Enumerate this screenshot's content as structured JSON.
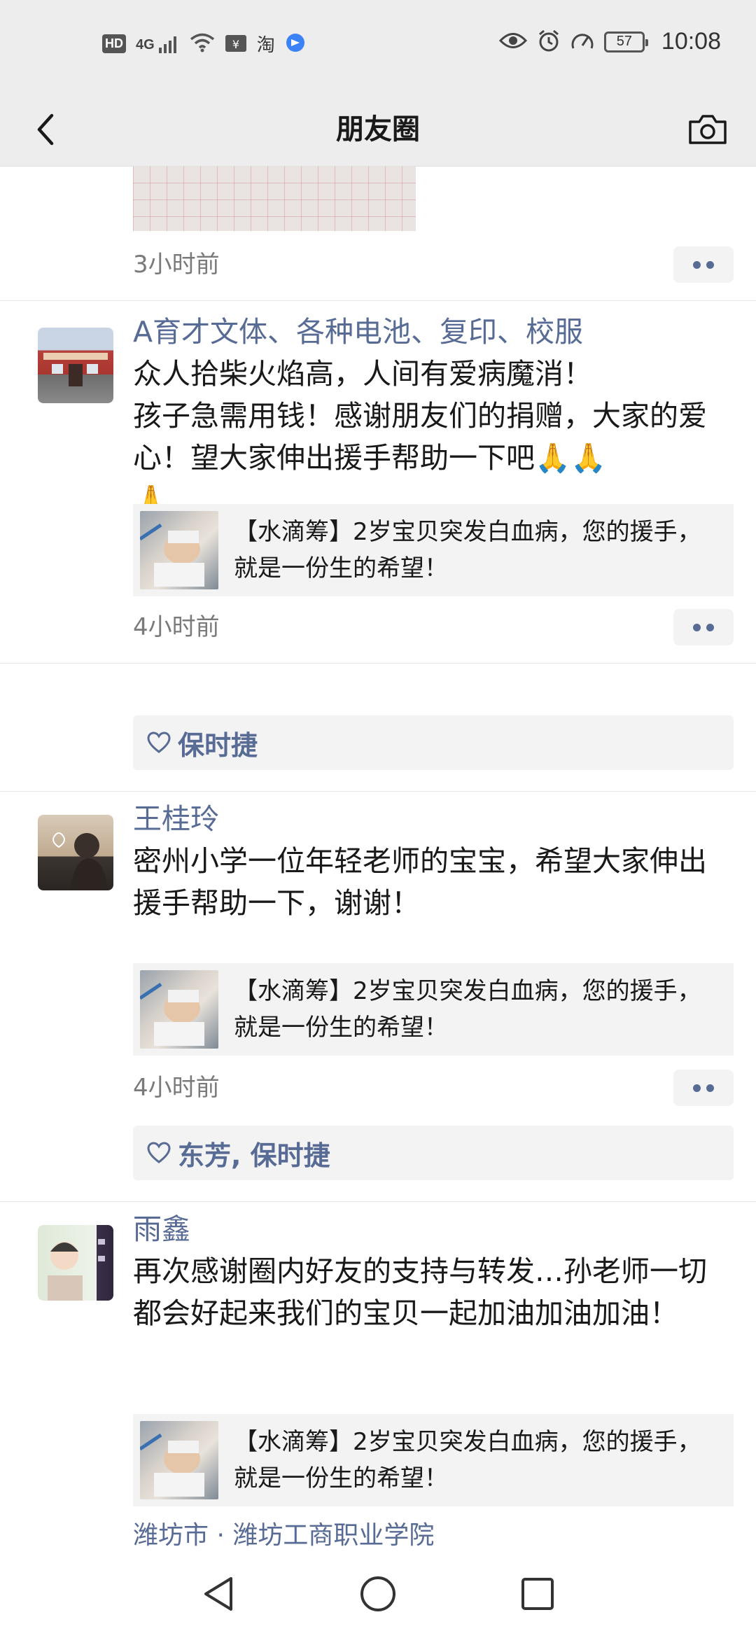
{
  "status_bar": {
    "left_labels": {
      "hd": "HD",
      "net": "4G",
      "taobao": "淘"
    },
    "battery": "57",
    "time": "10:08"
  },
  "header": {
    "title": "朋友圈"
  },
  "feed": {
    "previous_post": {
      "time": "3小时前"
    },
    "posts": [
      {
        "author": "A育才文体、各种电池、复印、校服",
        "text": "众人拾柴火焰高，人间有爱病魔消！\n孩子急需用钱！感谢朋友们的捐赠，大家的爱心！望大家伸出援手帮助一下吧🙏🙏\n🙏",
        "link": {
          "title": "【水滴筹】2岁宝贝突发白血病，您的援手，就是一份生的希望！"
        },
        "time": "4小时前",
        "likes": "保时捷"
      },
      {
        "author": "王桂玲",
        "text": "密州小学一位年轻老师的宝宝，希望大家伸出援手帮助一下，谢谢！",
        "link": {
          "title": "【水滴筹】2岁宝贝突发白血病，您的援手，就是一份生的希望！"
        },
        "time": "4小时前",
        "likes": "东芳, 保时捷"
      },
      {
        "author": "雨鑫",
        "text": "再次感谢圈内好友的支持与转发…孙老师一切都会好起来我们的宝贝一起加油加油加油！",
        "link": {
          "title": "【水滴筹】2岁宝贝突发白血病，您的援手，就是一份生的希望！"
        },
        "location": "潍坊市 · 潍坊工商职业学院"
      }
    ]
  },
  "icons": {
    "back": "chevron-left-icon",
    "camera": "camera-icon",
    "more": "more-dots-icon",
    "like": "heart-outline-icon",
    "nav_back": "triangle-back-icon",
    "nav_home": "circle-home-icon",
    "nav_recent": "square-recent-icon"
  },
  "colors": {
    "link_blue": "#576b95",
    "header_bg": "#ededed",
    "card_bg": "#f3f3f3"
  }
}
